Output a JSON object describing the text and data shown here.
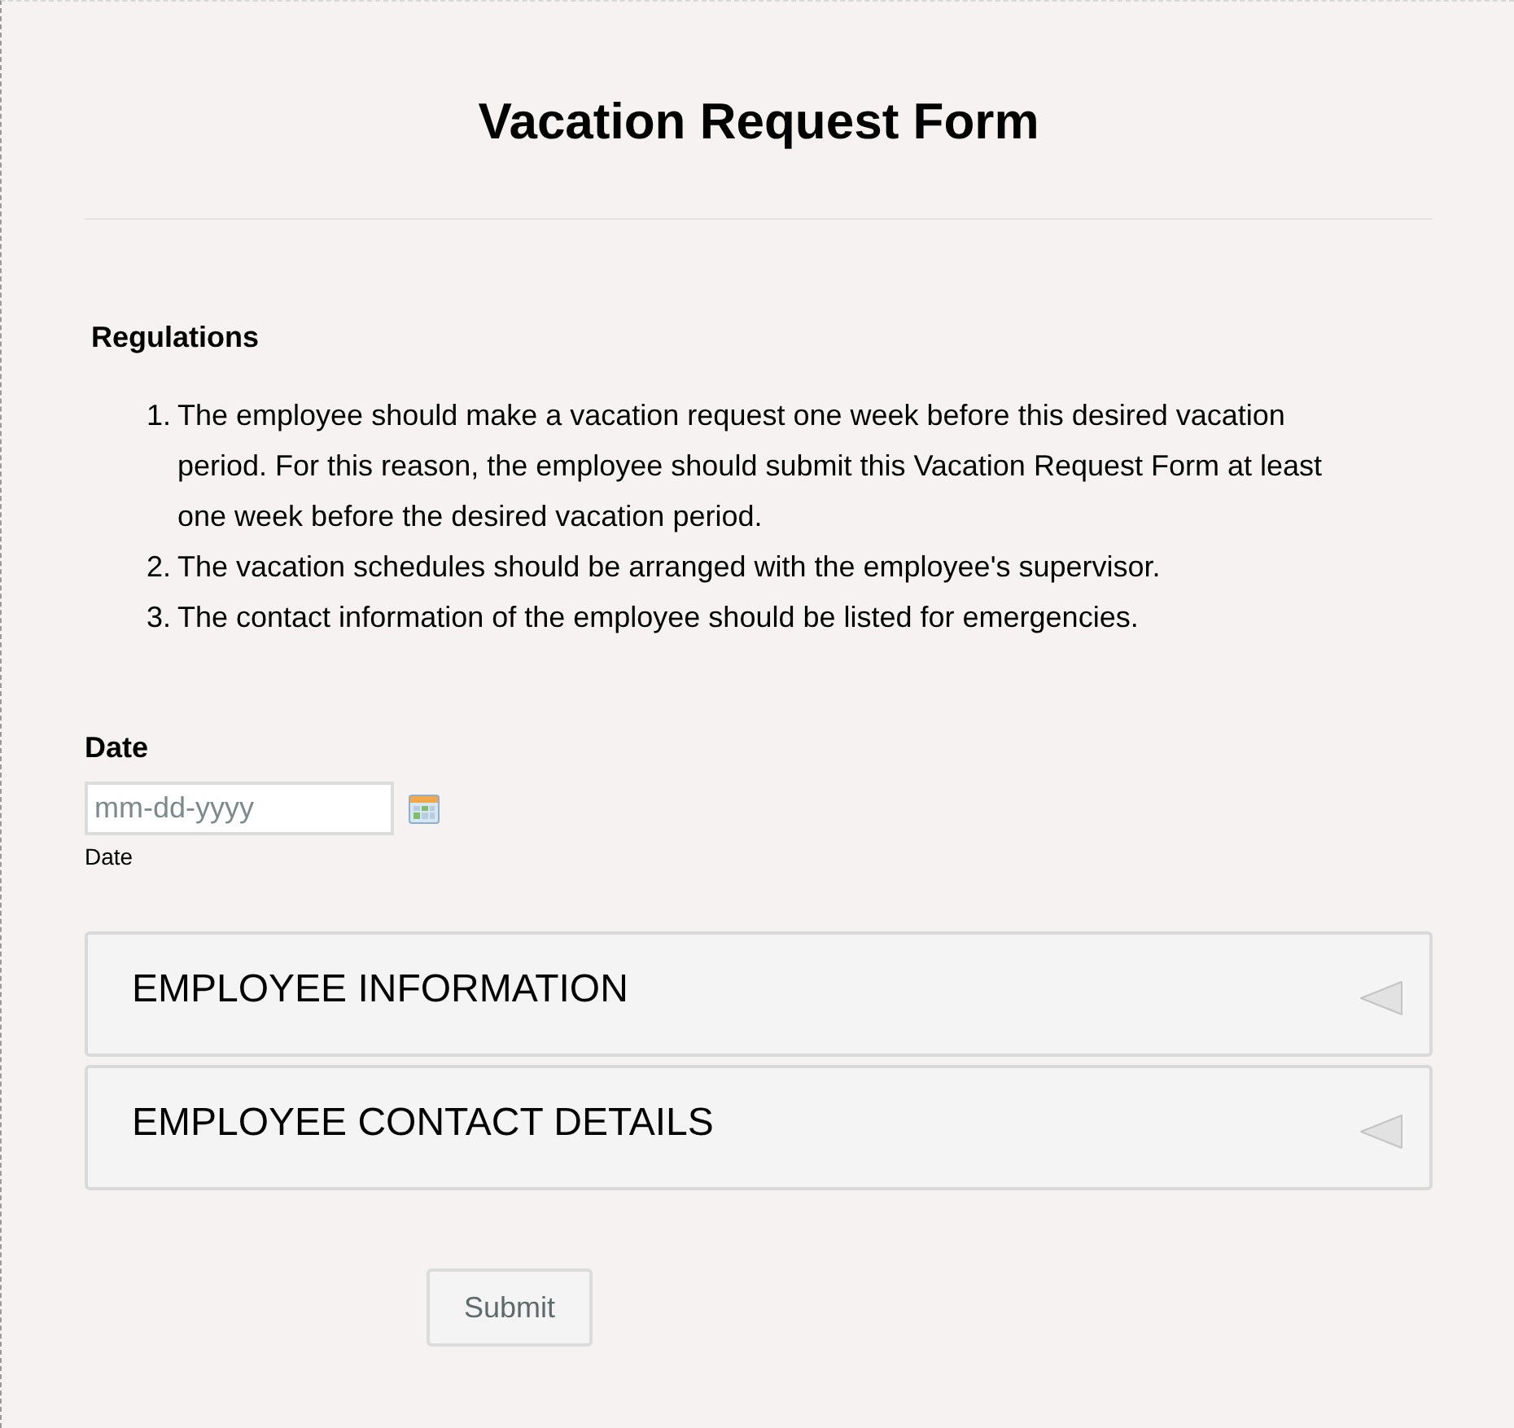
{
  "title": "Vacation Request Form",
  "regulations": {
    "heading": "Regulations",
    "items": [
      {
        "number": "1.",
        "text": "The employee should make a vacation request one week before this desired vacation period. For this reason, the employee should submit this Vacation Request Form at least one week before the desired vacation period."
      },
      {
        "number": "2.",
        "text": "The vacation schedules should be arranged with the employee's supervisor."
      },
      {
        "number": "3.",
        "text": "The contact information of the employee should be listed for emergencies."
      }
    ]
  },
  "date_field": {
    "label": "Date",
    "placeholder": "mm-dd-yyyy",
    "sublabel": "Date"
  },
  "sections": [
    {
      "title": "EMPLOYEE INFORMATION",
      "expanded": false
    },
    {
      "title": "EMPLOYEE CONTACT DETAILS",
      "expanded": false
    }
  ],
  "submit_button": {
    "label": "Submit"
  }
}
